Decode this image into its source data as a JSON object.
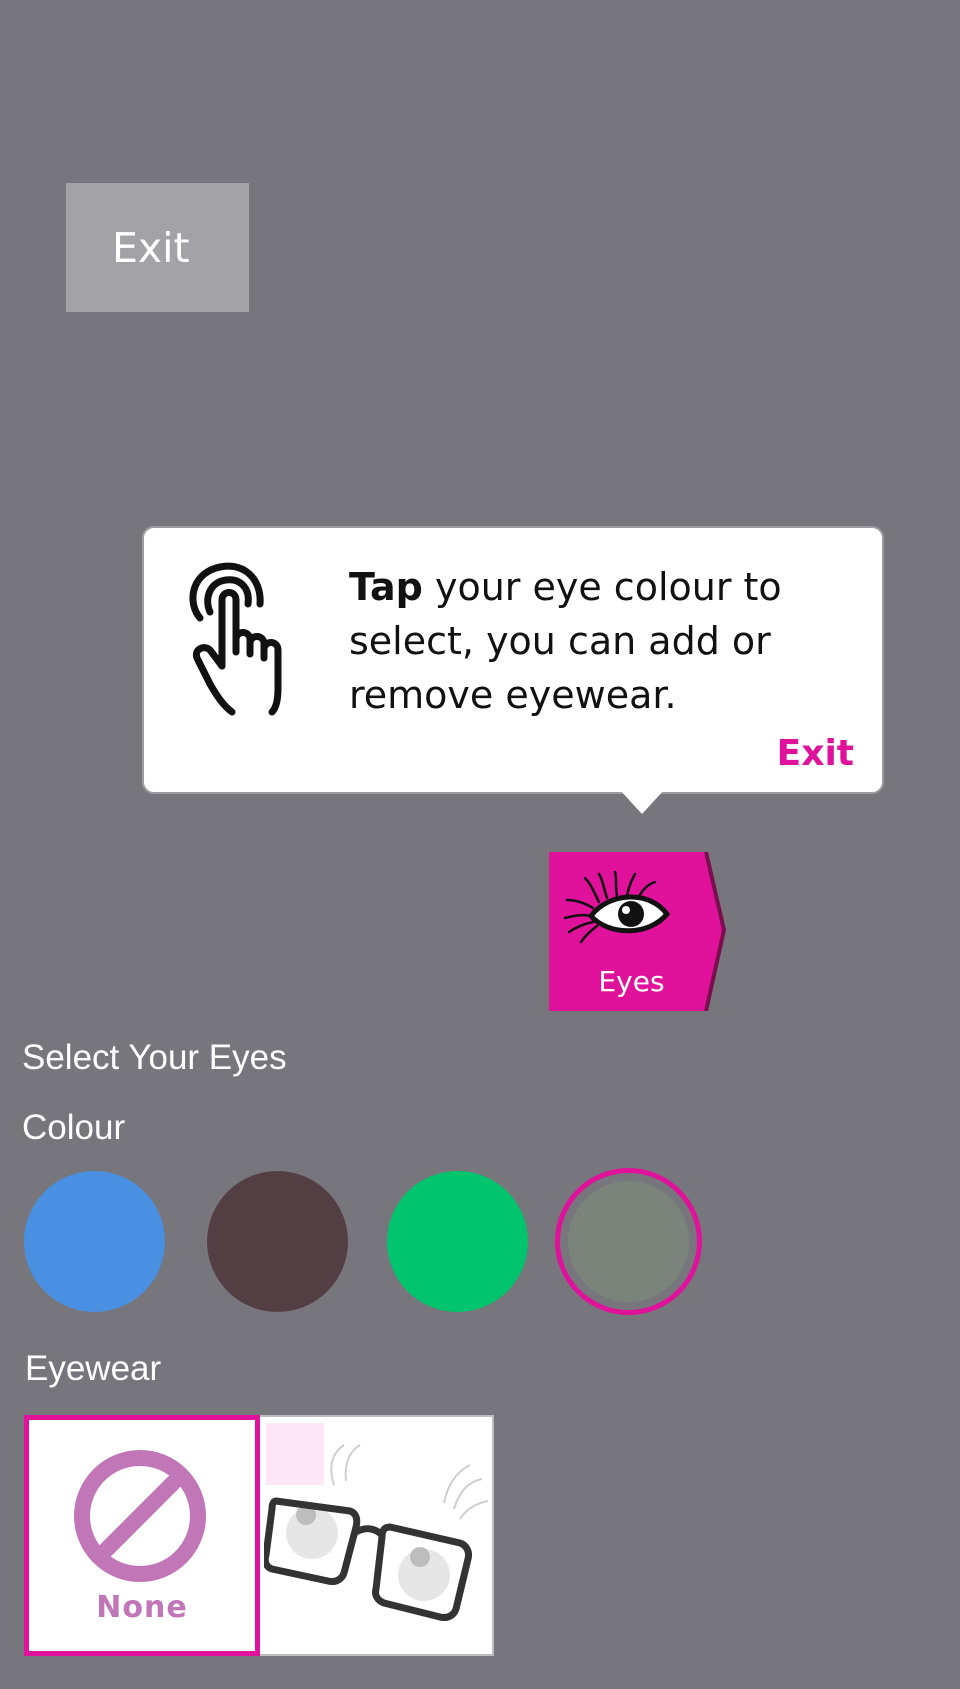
{
  "header": {
    "exit_label": "Exit"
  },
  "tooltip": {
    "bold_word": "Tap",
    "message": " your eye colour to select, you can add or remove eyewear.",
    "exit_label": "Exit",
    "icon": "tap-hand-icon"
  },
  "tab": {
    "label": "Eyes",
    "icon": "eye-lashes-icon",
    "color": "#e0119a"
  },
  "panel": {
    "title": "Select Your Eyes",
    "colour_label": "Colour",
    "colours": [
      {
        "name": "blue",
        "hex": "#4a90e2"
      },
      {
        "name": "brown",
        "hex": "#533f43"
      },
      {
        "name": "green",
        "hex": "#00c46e"
      },
      {
        "name": "grey",
        "hex": "#7a847b",
        "selected": true
      }
    ],
    "eyewear_label": "Eyewear",
    "eyewear_options": [
      {
        "label": "None",
        "icon": "none-prohibited-icon",
        "selected": true
      },
      {
        "label": "",
        "icon": "glasses-icon",
        "selected": false
      }
    ]
  },
  "colors": {
    "background": "#77767c",
    "accent": "#e0119a",
    "exit_button_bg": "#a3a2a7"
  }
}
